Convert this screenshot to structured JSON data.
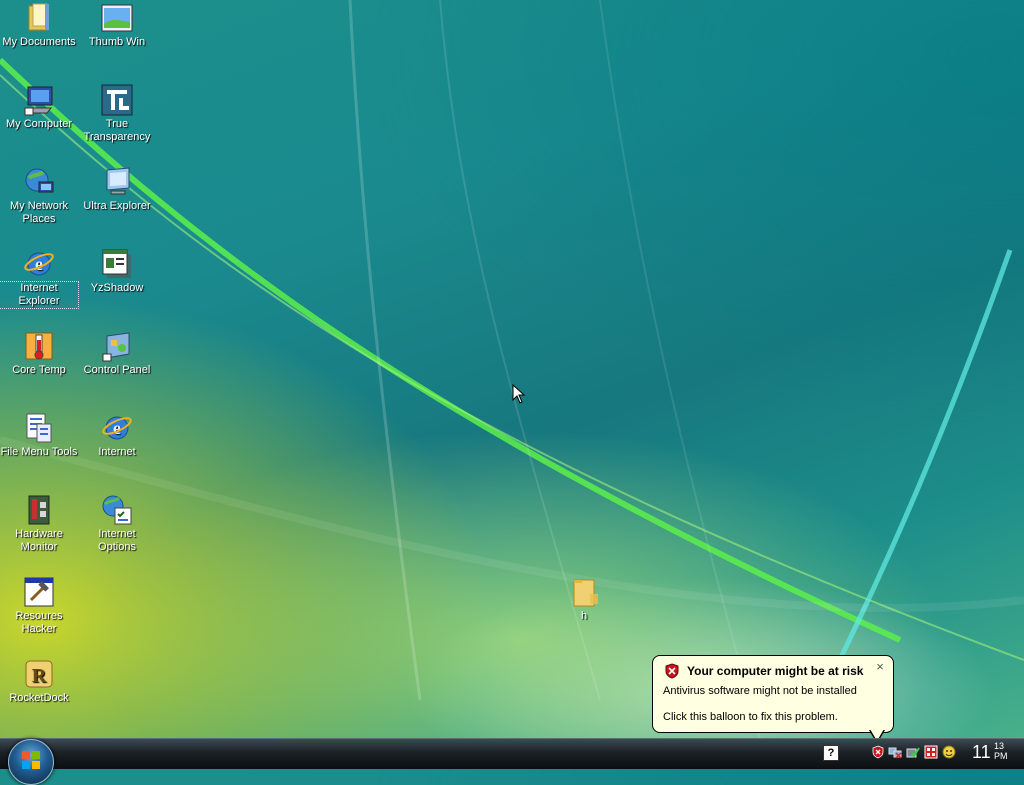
{
  "desktop": {
    "icons": [
      {
        "label": "My Documents"
      },
      {
        "label": "My Computer"
      },
      {
        "label": "My Network Places"
      },
      {
        "label": "Internet Explorer"
      },
      {
        "label": "Core Temp"
      },
      {
        "label": "File Menu Tools"
      },
      {
        "label": "Hardware Monitor"
      },
      {
        "label": "Resoures Hacker"
      },
      {
        "label": "RocketDock"
      },
      {
        "label": "Thumb Win"
      },
      {
        "label": "True Transparency"
      },
      {
        "label": "Ultra Explorer"
      },
      {
        "label": "YzShadow"
      },
      {
        "label": "Control Panel"
      },
      {
        "label": "Internet"
      },
      {
        "label": "Internet Options"
      },
      {
        "label": "h"
      }
    ]
  },
  "balloon": {
    "title": "Your computer might be at risk",
    "line1": "Antivirus software might not be installed",
    "line2": "Click this balloon to fix this problem.",
    "close": "×"
  },
  "taskbar": {
    "clock_hour": "11",
    "clock_minutes": "13",
    "clock_period": "PM",
    "help_glyph": "?"
  },
  "colors": {
    "balloon_bg": "#ffffe1",
    "security_red": "#c4161c",
    "taskbar": "#1b2125"
  }
}
